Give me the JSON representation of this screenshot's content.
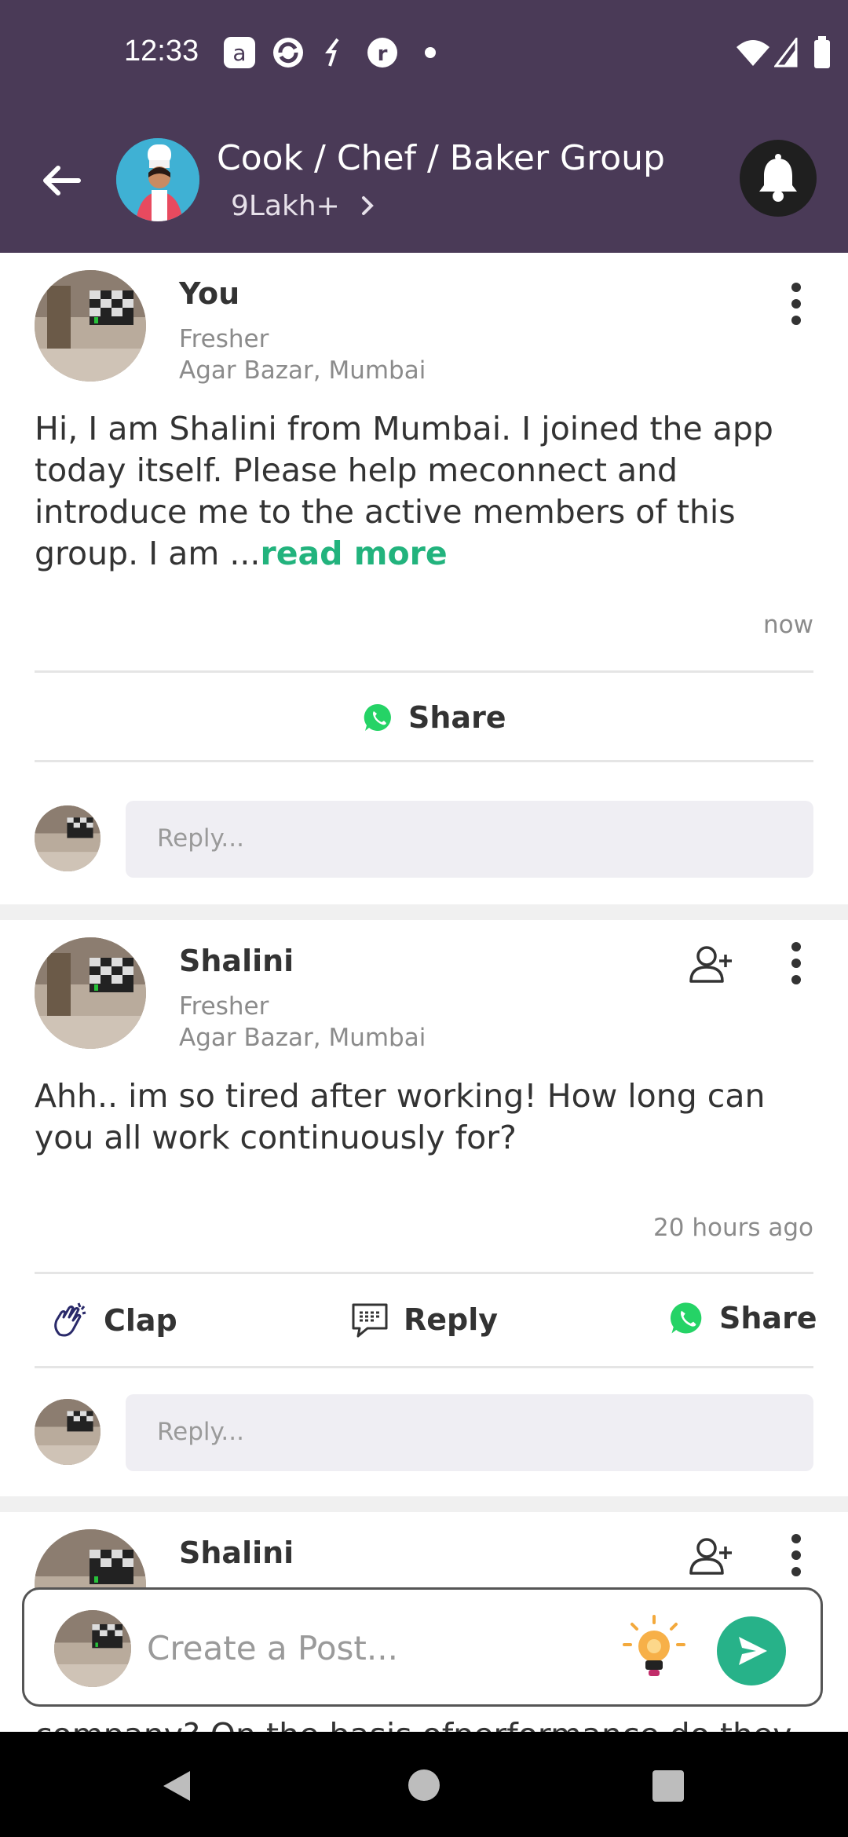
{
  "status_bar": {
    "time": "12:33"
  },
  "header": {
    "title": "Cook / Chef / Baker Group",
    "members": "9Lakh+",
    "colors": {
      "bar": "#4a3a57"
    }
  },
  "posts": [
    {
      "author": "You",
      "experience": "Fresher",
      "location": "Agar Bazar, Mumbai",
      "text": "Hi, I am Shalini from Mumbai. I joined the app today itself. Please help meconnect and introduce me to the active members of this group. I am ...",
      "read_more": "read more",
      "time": "now",
      "share_label": "Share",
      "reply_placeholder": "Reply..."
    },
    {
      "author": "Shalini",
      "experience": "Fresher",
      "location": "Agar Bazar, Mumbai",
      "text": "Ahh.. im so tired after working! How long can you all work continuously for?",
      "time": "20 hours ago",
      "clap_label": "Clap",
      "reply_label": "Reply",
      "share_label": "Share",
      "reply_placeholder": "Reply..."
    },
    {
      "author": "Shalini",
      "partial_text": "company? On the basis ofperformance do they"
    }
  ],
  "composer": {
    "placeholder": "Create a Post..."
  },
  "colors": {
    "accent_green": "#22b37d",
    "whatsapp": "#25d366"
  }
}
